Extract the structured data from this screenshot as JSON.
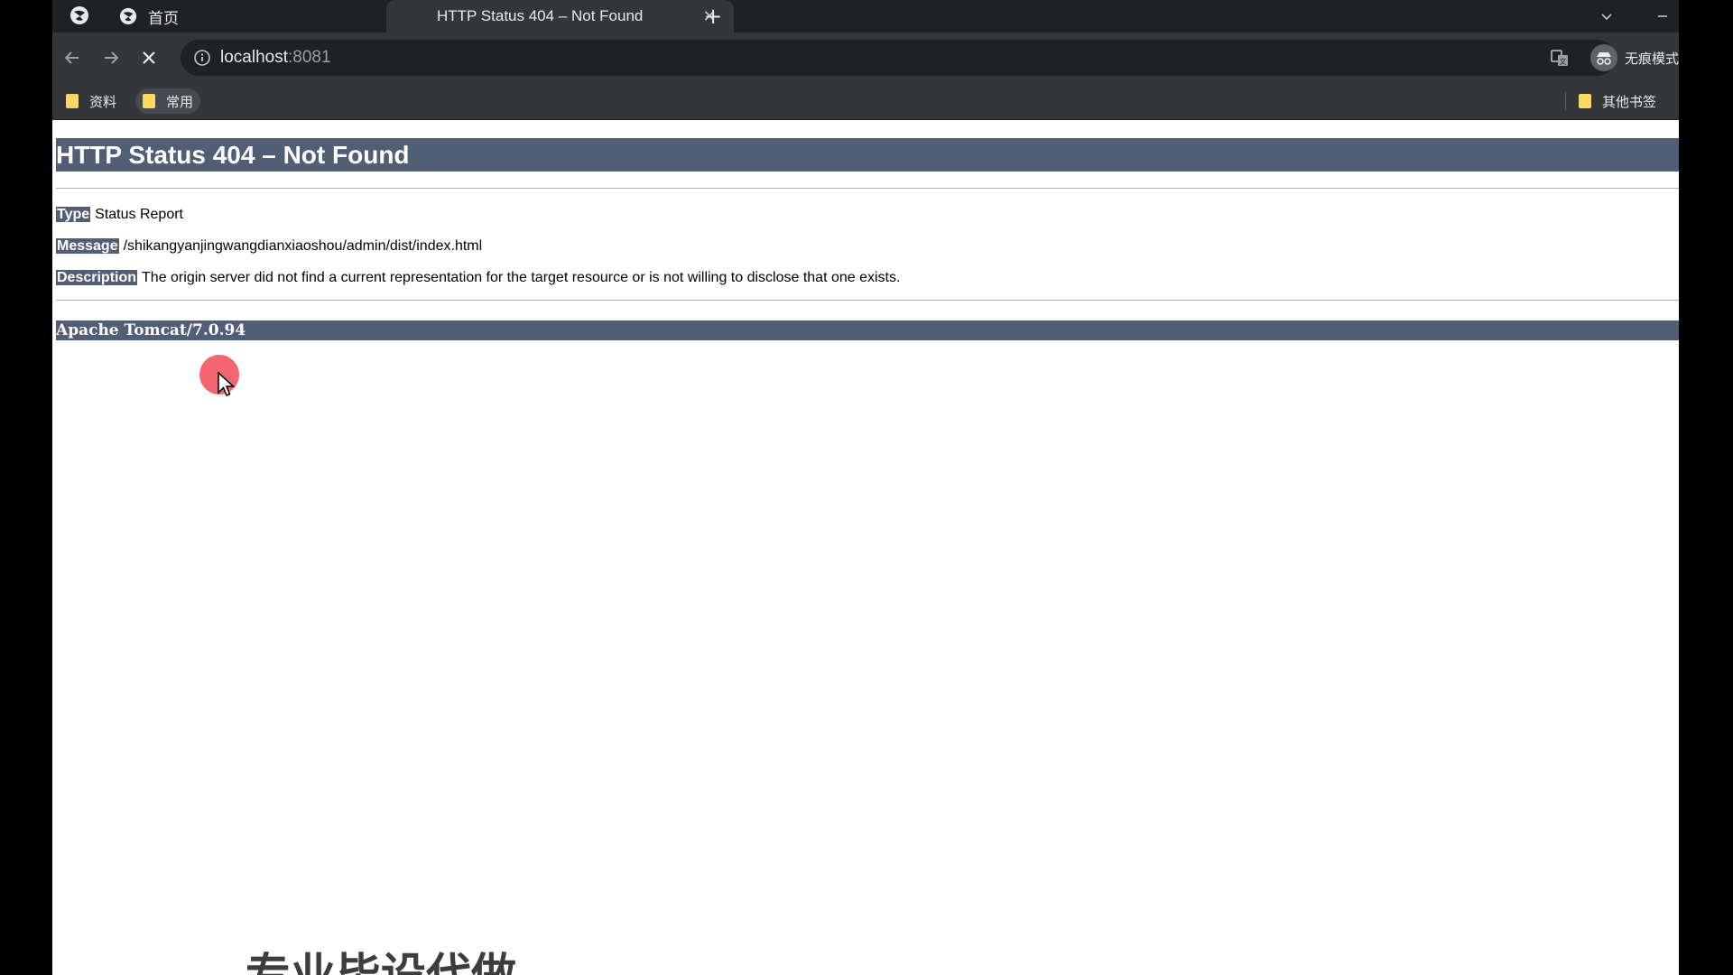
{
  "tabs": [
    {
      "title": "首页",
      "state": "inactive"
    },
    {
      "title": "HTTP Status 404 – Not Found",
      "state": "active"
    }
  ],
  "toolbar": {
    "url_host": "localhost",
    "url_port": ":8081",
    "profile_label": "无痕模式"
  },
  "bookmarks": {
    "items": [
      {
        "label": "资料"
      },
      {
        "label": "常用"
      }
    ],
    "other_label": "其他书签"
  },
  "page": {
    "heading": "HTTP Status 404 – Not Found",
    "type_label": "Type",
    "type_value": "Status Report",
    "message_label": "Message",
    "message_value": "/shikangyanjingwangdianxiaoshou/admin/dist/index.html",
    "description_label": "Description",
    "description_value": "The origin server did not find a current representation for the target resource or is not willing to disclose that one exists.",
    "footer": "Apache Tomcat/7.0.94"
  },
  "overlay": {
    "watermark_text": "专业毕设代做"
  },
  "colors": {
    "tomcat_header": "#525d76",
    "cursor_highlight": "#f2545f",
    "bookmark_star": "#8ab4f8",
    "folder": "#fdd663"
  },
  "icons": {
    "browser_logo": "browser-logo-icon",
    "favicon": "globe-icon",
    "close": "close-icon",
    "new_tab": "plus-icon",
    "back": "back-arrow-icon",
    "forward": "forward-arrow-icon",
    "stop": "stop-loading-icon",
    "info": "info-icon",
    "translate": "translate-icon",
    "star": "star-icon",
    "incognito": "incognito-icon",
    "folder": "folder-icon"
  }
}
